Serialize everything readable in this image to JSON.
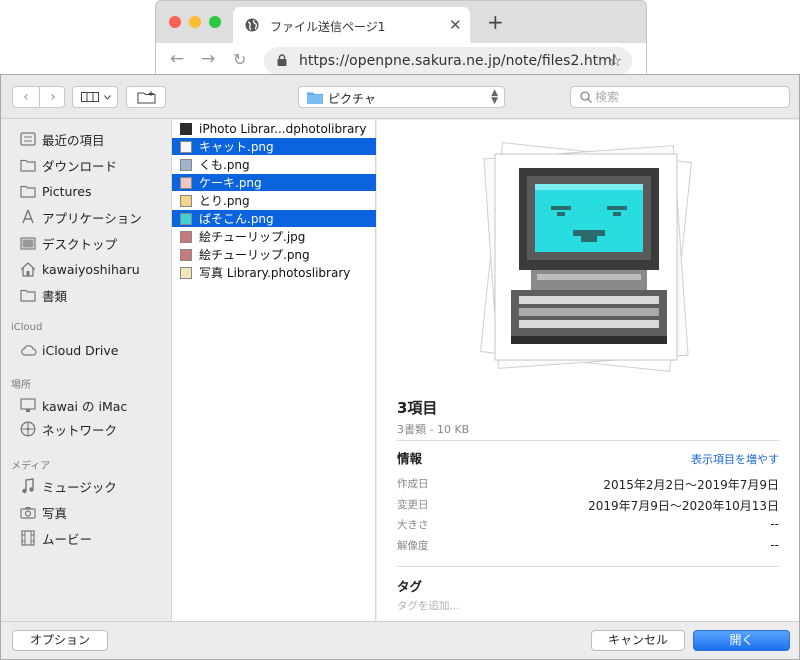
{
  "browser": {
    "tab_title": "ファイル送信ページ1",
    "url": "https://openpne.sakura.ne.jp/note/files2.html"
  },
  "toolbar": {
    "location": "ピクチャ",
    "search_placeholder": "検索"
  },
  "sidebar": {
    "favorites": [
      {
        "label": "最近の項目",
        "icon": "recents-icon"
      },
      {
        "label": "ダウンロード",
        "icon": "folder-icon"
      },
      {
        "label": "Pictures",
        "icon": "folder-icon"
      },
      {
        "label": "アプリケーション",
        "icon": "applications-icon"
      },
      {
        "label": "デスクトップ",
        "icon": "desktop-icon"
      },
      {
        "label": "kawaiyoshiharu",
        "icon": "home-icon"
      },
      {
        "label": "書類",
        "icon": "folder-icon"
      }
    ],
    "icloud_header": "iCloud",
    "icloud": [
      {
        "label": "iCloud Drive",
        "icon": "cloud-icon"
      }
    ],
    "places_header": "場所",
    "places": [
      {
        "label": "kawai の iMac",
        "icon": "imac-icon"
      },
      {
        "label": "ネットワーク",
        "icon": "network-icon"
      }
    ],
    "media_header": "メディア",
    "media": [
      {
        "label": "ミュージック",
        "icon": "music-icon"
      },
      {
        "label": "写真",
        "icon": "camera-icon"
      },
      {
        "label": "ムービー",
        "icon": "film-icon"
      }
    ]
  },
  "files": [
    {
      "name": "iPhoto Librar...dphotolibrary",
      "selected": false
    },
    {
      "name": "キャット.png",
      "selected": true
    },
    {
      "name": "くも.png",
      "selected": false
    },
    {
      "name": "ケーキ.png",
      "selected": true
    },
    {
      "name": "とり.png",
      "selected": false
    },
    {
      "name": "ぱそこん.png",
      "selected": true
    },
    {
      "name": "絵チューリップ.jpg",
      "selected": false
    },
    {
      "name": "絵チューリップ.png",
      "selected": false
    },
    {
      "name": "写真 Library.photoslibrary",
      "selected": false
    }
  ],
  "preview": {
    "title": "3項目",
    "subtitle": "3書類 - 10 KB",
    "info_header": "情報",
    "show_more": "表示項目を増やす",
    "rows": [
      {
        "key": "作成日",
        "value": "2015年2月2日〜2019年7月9日"
      },
      {
        "key": "変更日",
        "value": "2019年7月9日〜2020年10月13日"
      },
      {
        "key": "大きさ",
        "value": "--"
      },
      {
        "key": "解像度",
        "value": "--"
      }
    ],
    "tag_header": "タグ",
    "tag_placeholder": "タグを追加..."
  },
  "buttons": {
    "options": "オプション",
    "cancel": "キャンセル",
    "open": "開く"
  },
  "colors": {
    "selection": "#0b63dd",
    "primary_button": "#1a72ef",
    "link": "#1a66d6"
  }
}
